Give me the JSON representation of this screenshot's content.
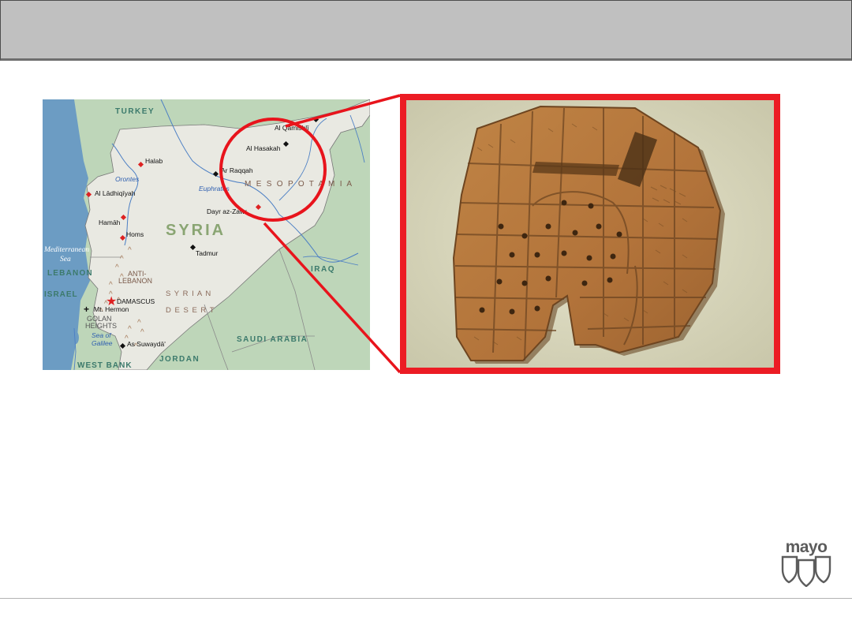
{
  "slide": {
    "title": ""
  },
  "map": {
    "countries": {
      "turkey": "TURKEY",
      "syria": "SYRIA",
      "lebanon": "LEBANON",
      "israel": "ISRAEL",
      "iraq": "IRAQ",
      "jordan": "JORDAN",
      "saudi_arabia": "SAUDI ARABIA",
      "west_bank": "WEST BANK"
    },
    "regions": {
      "mesopotamia": "M E S O P O T A M I A",
      "syrian_desert_line1": "S   Y   R   I   A   N",
      "syrian_desert_line2": "D   E   S   E   R   T",
      "anti_lebanon_1": "ANTI-",
      "anti_lebanon_2": "LEBANON",
      "golan_1": "GOLAN",
      "golan_2": "HEIGHTS"
    },
    "water": {
      "sea_1": "Mediterranean",
      "sea_2": "Sea",
      "orontes": "Orontes",
      "euphrates": "Euphrates",
      "galilee_1": "Sea of",
      "galilee_2": "Galilee"
    },
    "cities": {
      "al_qamishli": "Al Qamishlī",
      "al_hasakah": "Al Hasakah",
      "halab": "Halab",
      "ar_raqqah": "Ar Raqqah",
      "al_ladhiqiyah": "Al Lādhiqīyah",
      "dayr_az_zawr": "Dayr az-Zawr",
      "hamah": "Hamāh",
      "homs": "Homs",
      "tadmur": "Tadmur",
      "damascus": "DAMASCUS",
      "mt_hermon": "Mt. Hermon",
      "as_suwayda": "As Suwaydā'"
    },
    "colors": {
      "land": "#e9e9e2",
      "neighbor_land": "#bed6b9",
      "sea": "#6c9cc3",
      "river": "#4c7fc4",
      "highlight": "#e8141c"
    }
  },
  "photo": {
    "subject": "clay-tablet",
    "colors": {
      "background": "#dcdcc0",
      "clay": "#b7793a",
      "frame": "#ec1c24"
    }
  },
  "logo": {
    "word": "mayo"
  }
}
